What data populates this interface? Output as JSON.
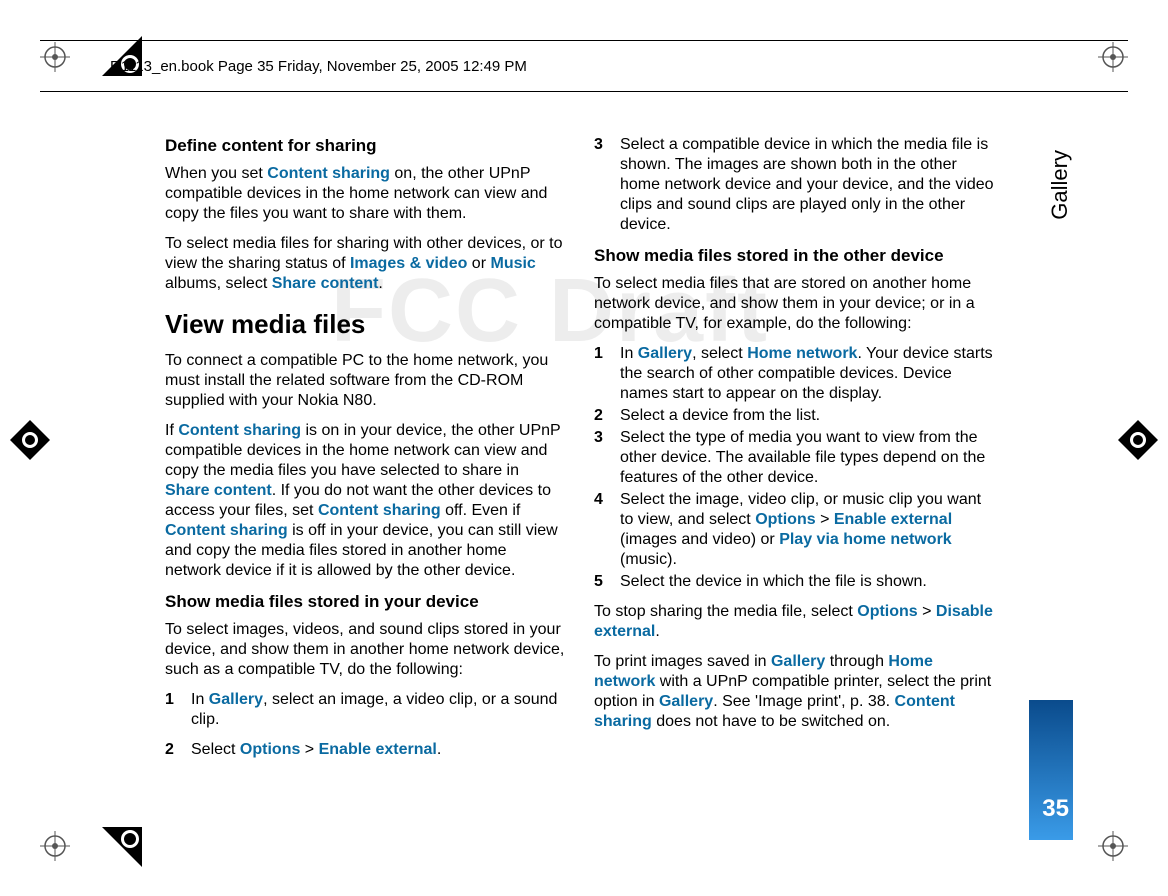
{
  "header": {
    "text": "R1113_en.book  Page 35  Friday, November 25, 2005  12:49 PM"
  },
  "watermark": "FCC Draft",
  "side_label": "Gallery",
  "page_number": "35",
  "col1": {
    "h_define": "Define content for sharing",
    "p1_a": "When you set ",
    "p1_link1": "Content sharing",
    "p1_b": " on, the other UPnP compatible devices in the home network can view and copy the files you want to share with them.",
    "p2_a": "To select media files for sharing with other devices, or to view the sharing status of ",
    "p2_link1": "Images & video",
    "p2_b": " or ",
    "p2_link2": "Music",
    "p2_c": " albums, select ",
    "p2_link3": "Share content",
    "p2_d": ".",
    "h_view": "View media files",
    "p3": "To connect a compatible PC to the home network, you must install the related software from the CD-ROM supplied with your Nokia N80.",
    "p4_a": "If ",
    "p4_link1": "Content sharing",
    "p4_b": " is on in your device, the other UPnP compatible devices in the home network can view and copy the media files you have selected to share in ",
    "p4_link2": "Share content",
    "p4_c": ". If you do not want the other devices to access your files, set ",
    "p4_link3": "Content sharing",
    "p4_d": " off. Even if ",
    "p4_link4": "Content sharing",
    "p4_e": " is off in your device, you can still view and copy the media files stored in another home network device if it is allowed by the other device.",
    "h_show1": "Show media files stored in your device",
    "p5": "To select images, videos, and sound clips stored in your device, and show them in another home network device, such as a compatible TV, do the following:",
    "s1_num": "1",
    "s1_a": "In ",
    "s1_link1": "Gallery",
    "s1_b": ", select an image, a video clip, or a sound clip."
  },
  "col2": {
    "s2_num": "2",
    "s2_a": "Select ",
    "s2_link1": "Options",
    "s2_sep": " > ",
    "s2_link2": "Enable external",
    "s2_b": ".",
    "s3_num": "3",
    "s3": "Select a compatible device in which the media file is shown. The images are shown both in the other home network device and your device, and the video clips and sound clips are played only in the other device.",
    "h_show2": "Show media files stored in the other device",
    "p6": "To select media files that are stored on another home network device, and show them in your device; or in a compatible TV, for example, do the following:",
    "t1_num": "1",
    "t1_a": "In ",
    "t1_link1": "Gallery",
    "t1_b": ", select ",
    "t1_link2": "Home network",
    "t1_c": ". Your device starts the search of other compatible devices. Device names start to appear on the display.",
    "t2_num": "2",
    "t2": "Select a device from the list.",
    "t3_num": "3",
    "t3": "Select the type of media you want to view from the other device. The available file types depend on the features of the other device.",
    "t4_num": "4",
    "t4_a": "Select the image, video clip, or music clip you want to view, and select ",
    "t4_link1": "Options",
    "t4_sep1": " > ",
    "t4_link2": "Enable external",
    "t4_b": " (images and video) or ",
    "t4_link3": "Play via home network",
    "t4_c": " (music).",
    "t5_num": "5",
    "t5": "Select the device in which the file is shown.",
    "p7_a": "To stop sharing the media file, select ",
    "p7_link1": "Options",
    "p7_sep": " > ",
    "p7_link2": "Disable external",
    "p7_b": ".",
    "p8_a": "To print images saved in ",
    "p8_link1": "Gallery",
    "p8_b": " through ",
    "p8_link2": "Home network",
    "p8_c": " with a UPnP compatible printer, select the print option in ",
    "p8_link3": "Gallery",
    "p8_d": ". See 'Image print', p. 38. ",
    "p8_link4": "Content sharing",
    "p8_e": " does not have to be switched on."
  }
}
